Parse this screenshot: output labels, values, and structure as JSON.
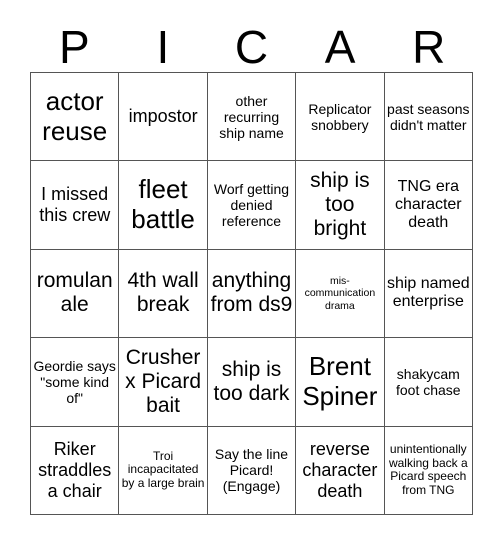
{
  "header": {
    "letters": [
      "P",
      "I",
      "C",
      "A",
      "R"
    ]
  },
  "grid": {
    "rows": [
      [
        {
          "text": "actor reuse",
          "size": "xl"
        },
        {
          "text": "impostor",
          "size": "m"
        },
        {
          "text": "other recurring ship name",
          "size": "s"
        },
        {
          "text": "Replicator snobbery",
          "size": "s"
        },
        {
          "text": "past seasons didn't matter",
          "size": "s"
        }
      ],
      [
        {
          "text": "I missed this crew",
          "size": "m"
        },
        {
          "text": "fleet battle",
          "size": "xl"
        },
        {
          "text": "Worf getting denied reference",
          "size": "s"
        },
        {
          "text": "ship is too bright",
          "size": "l"
        },
        {
          "text": "TNG era character death",
          "size": "ms"
        }
      ],
      [
        {
          "text": "romulan ale",
          "size": "l"
        },
        {
          "text": "4th wall break",
          "size": "l"
        },
        {
          "text": "anything from ds9",
          "size": "l"
        },
        {
          "text": "mis-communication drama",
          "size": "xxs"
        },
        {
          "text": "ship named enterprise",
          "size": "ms"
        }
      ],
      [
        {
          "text": "Geordie says \"some kind of\"",
          "size": "s"
        },
        {
          "text": "Crusher x Picard bait",
          "size": "l"
        },
        {
          "text": "ship is too dark",
          "size": "l"
        },
        {
          "text": "Brent Spiner",
          "size": "xl"
        },
        {
          "text": "shakycam foot chase",
          "size": "s"
        }
      ],
      [
        {
          "text": "Riker straddles a chair",
          "size": "m"
        },
        {
          "text": "Troi incapacitated by a large brain",
          "size": "xs"
        },
        {
          "text": "Say the line Picard! (Engage)",
          "size": "s"
        },
        {
          "text": "reverse character death",
          "size": "m"
        },
        {
          "text": "unintentionally walking back a Picard speech from TNG",
          "size": "xs"
        }
      ]
    ]
  }
}
